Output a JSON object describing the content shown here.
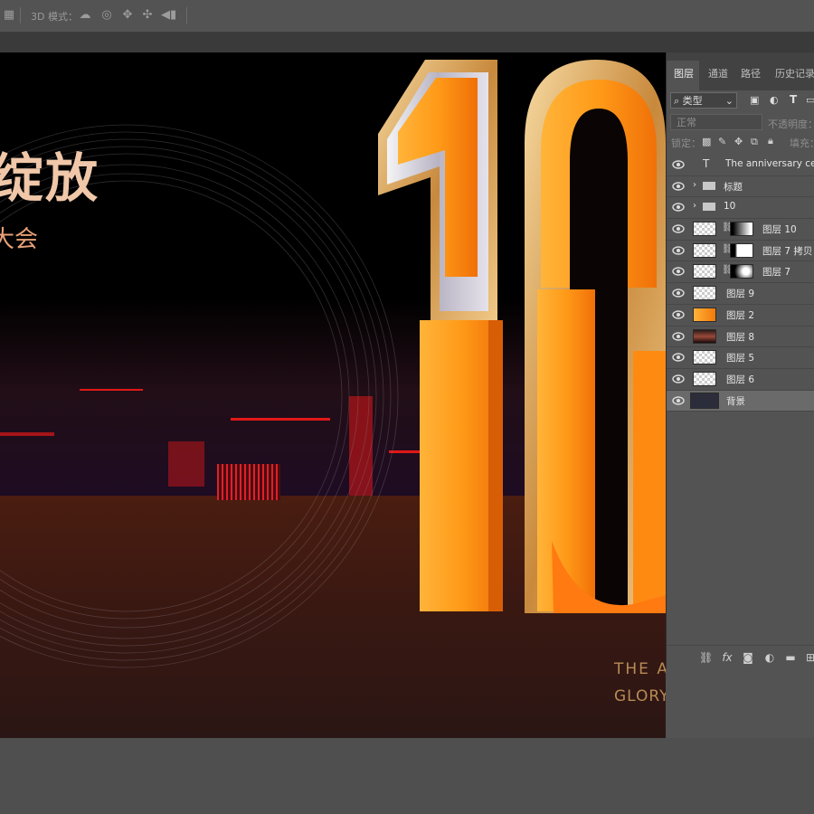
{
  "optionsbar": {
    "mode_label": "3D 模式：",
    "icons": [
      "layout-icon",
      "3d-rotate-icon",
      "3d-roll-icon",
      "3d-pan-icon",
      "3d-slide-icon",
      "3d-scale-icon"
    ]
  },
  "canvas": {
    "headline": "绽放",
    "subline": "大会",
    "big_number": "10",
    "english_line1": "THE ANNIVERSARY CELEB",
    "english_line2": "GLORY BLOSSOMS"
  },
  "layers_panel": {
    "tabs": [
      {
        "label": "图层",
        "active": true
      },
      {
        "label": "通道",
        "active": false
      },
      {
        "label": "路径",
        "active": false
      },
      {
        "label": "历史记录",
        "active": false
      }
    ],
    "filter_kind": "类型",
    "blend_mode": "正常",
    "opacity_label": "不透明度：",
    "lock_label": "锁定：",
    "fill_label": "填充：",
    "layers": [
      {
        "name": "The anniversary celebr",
        "type": "text",
        "selected": false
      },
      {
        "name": "标题",
        "type": "group",
        "selected": false
      },
      {
        "name": "10",
        "type": "group",
        "selected": false
      },
      {
        "name": "图层 10",
        "type": "masked",
        "selected": false
      },
      {
        "name": "图层 7 拷贝",
        "type": "masked",
        "selected": false
      },
      {
        "name": "图层 7",
        "type": "masked",
        "selected": false
      },
      {
        "name": "图层 9",
        "type": "pixel",
        "selected": false
      },
      {
        "name": "图层 2",
        "type": "pixel",
        "selected": false
      },
      {
        "name": "图层 8",
        "type": "pixel",
        "selected": false
      },
      {
        "name": "图层 5",
        "type": "pixel",
        "selected": false
      },
      {
        "name": "图层 6",
        "type": "pixel",
        "selected": false
      },
      {
        "name": "背景",
        "type": "background",
        "selected": true
      }
    ],
    "footer_icons": [
      "link-icon",
      "fx-icon",
      "mask-icon",
      "adjustment-icon",
      "folder-icon",
      "new-layer-icon"
    ]
  },
  "colors": {
    "ui_bg": "#535353",
    "accent_orange": "#ff8a12",
    "gold": "#b88b55"
  }
}
